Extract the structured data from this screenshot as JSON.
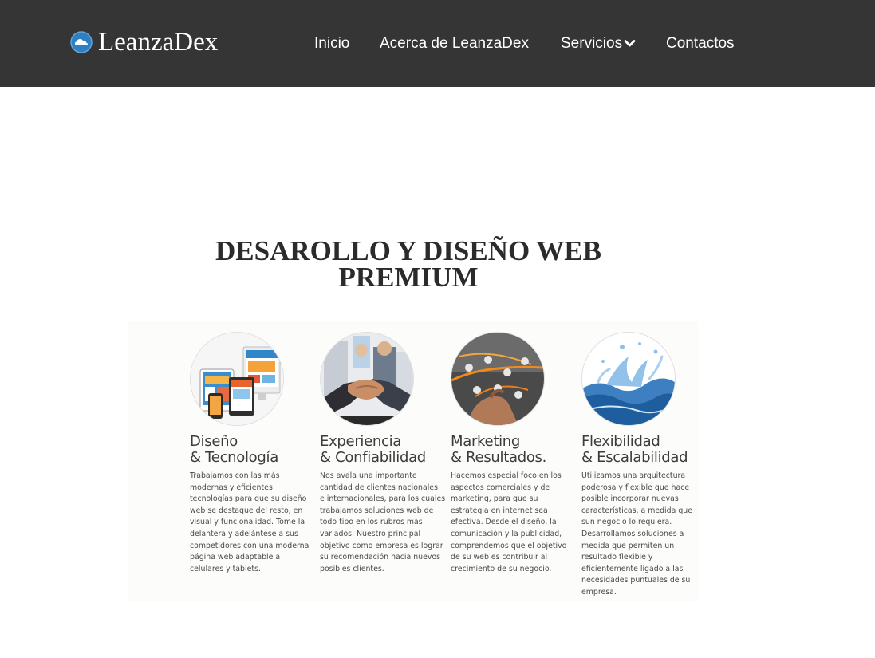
{
  "header": {
    "brand": "LeanzaDex",
    "nav": {
      "inicio": "Inicio",
      "acerca": "Acerca de LeanzaDex",
      "servicios": "Servicios",
      "contactos": "Contactos"
    },
    "colors": {
      "bar": "#353535",
      "text": "#ffffff",
      "logo_blue": "#2f7fc2"
    }
  },
  "hero": {
    "title_line1": "DESAROLLO Y DISEÑO WEB",
    "title_line2": "PREMIUM"
  },
  "features": [
    {
      "image": "devices-image",
      "title1": "Diseño",
      "title2": "& Tecnología",
      "lines": [
        "Trabajamos con las más",
        "modernas y eficientes",
        "tecnologías para que su diseño",
        "web se destaque del resto, en",
        "visual y funcionalidad. Tome la",
        "delantera y adelántese a sus",
        "competidores con una moderna",
        "página web adaptable a",
        "celulares y tablets."
      ]
    },
    {
      "image": "handshake-image",
      "title1": "Experiencia",
      "title2": "& Confiabilidad",
      "lines": [
        "Nos avala una importante",
        "cantidad de clientes nacionales",
        "e internacionales, para los cuales",
        "trabajamos soluciones web de",
        "todo tipo en los rubros más",
        "variados. Nuestro principal",
        "objetivo como empresa es lograr",
        "su recomendación hacia nuevos",
        "posibles clientes."
      ]
    },
    {
      "image": "network-image",
      "title1": "Marketing",
      "title2": "& Resultados.",
      "lines": [
        "Hacemos especial foco en los",
        "aspectos comerciales y de",
        "marketing, para que su",
        "estrategia en internet sea",
        "efectiva. Desde el diseño, la",
        "comunicación y la publicidad,",
        "comprendemos que el objetivo",
        "de su web es contribuir al",
        "crecimiento de su negocio."
      ]
    },
    {
      "image": "water-splash-image",
      "title1": "Flexibilidad",
      "title2": "& Escalabilidad",
      "lines": [
        "Utilizamos una arquitectura",
        "poderosa y flexible que hace",
        "posible incorporar nuevas",
        "características, a medida que",
        "sun negocio lo requiera.",
        "Desarrollamos soluciones a",
        "medida que permiten un",
        "resultado flexible y",
        "eficientemente ligado a las",
        "necesidades puntuales de su",
        "empresa."
      ]
    }
  ]
}
